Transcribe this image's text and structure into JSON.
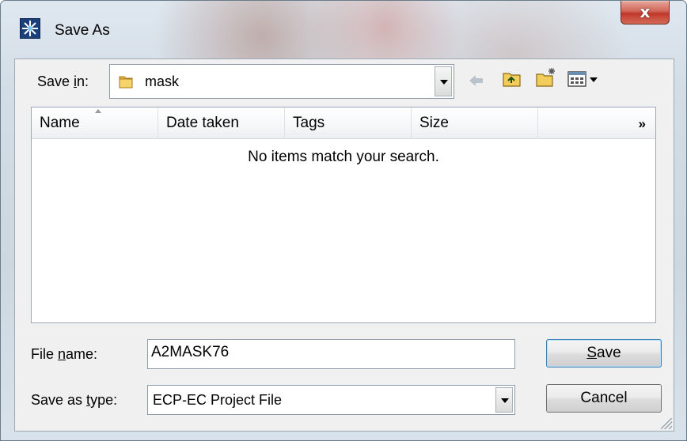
{
  "window": {
    "title": "Save As",
    "close_glyph": "x"
  },
  "toolbar": {
    "save_in_label_pre": "Save ",
    "save_in_label_mnemonic": "i",
    "save_in_label_post": "n:",
    "save_in_value": "mask",
    "icons": [
      "back-arrow-icon",
      "up-folder-icon",
      "new-folder-icon",
      "view-menu-icon"
    ]
  },
  "list": {
    "columns": [
      "Name",
      "Date taken",
      "Tags",
      "Size"
    ],
    "more_glyph": "»",
    "empty_message": "No items match your search."
  },
  "filename": {
    "label_pre": "File ",
    "label_mnemonic": "n",
    "label_post": "ame:",
    "value": "A2MASK76"
  },
  "filetype": {
    "label_pre": "Save as ",
    "label_mnemonic": "t",
    "label_post": "ype:",
    "value": "ECP-EC Project File"
  },
  "buttons": {
    "save_mnemonic": "S",
    "save_rest": "ave",
    "cancel": "Cancel"
  },
  "colors": {
    "close_red": "#c0392b",
    "default_button_border": "#3c7fb1",
    "folder_yellow": "#e8b640"
  }
}
